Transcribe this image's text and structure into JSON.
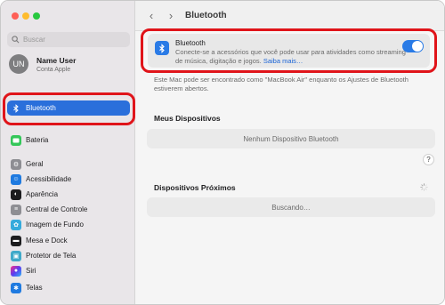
{
  "search": {
    "placeholder": "Buscar"
  },
  "user": {
    "initials": "UN",
    "name": "Name User",
    "subtitle": "Conta Apple"
  },
  "sidebar": {
    "items": [
      {
        "label": "Bluetooth",
        "icon": "bluetooth-icon"
      },
      {
        "label": "Bateria",
        "icon": "battery-icon"
      },
      {
        "label": "Geral",
        "icon": "gear-icon"
      },
      {
        "label": "Acessibilidade",
        "icon": "accessibility-icon"
      },
      {
        "label": "Aparência",
        "icon": "appearance-icon"
      },
      {
        "label": "Central de Controle",
        "icon": "control-center-icon"
      },
      {
        "label": "Imagem de Fundo",
        "icon": "wallpaper-icon"
      },
      {
        "label": "Mesa e Dock",
        "icon": "desktop-dock-icon"
      },
      {
        "label": "Protetor de Tela",
        "icon": "screensaver-icon"
      },
      {
        "label": "Siri",
        "icon": "siri-icon"
      },
      {
        "label": "Telas",
        "icon": "displays-icon"
      }
    ]
  },
  "toolbar": {
    "title": "Bluetooth"
  },
  "bluetooth": {
    "title": "Bluetooth",
    "description": "Conecte-se a acessórios que você pode usar para atividades como streaming de música, digitação e jogos.",
    "link": "Saiba mais…",
    "enabled": true,
    "discoverable_text": "Este Mac pode ser encontrado como \"MacBook Air\" enquanto os Ajustes de Bluetooth estiverem abertos."
  },
  "my_devices": {
    "heading": "Meus Dispositivos",
    "empty": "Nenhum Dispositivo Bluetooth"
  },
  "nearby": {
    "heading": "Dispositivos Próximos",
    "status": "Buscando…"
  },
  "help": {
    "label": "?"
  },
  "colors": {
    "accent": "#2a7be6",
    "highlight": "#e0141a",
    "selected": "#2a6fdb"
  }
}
